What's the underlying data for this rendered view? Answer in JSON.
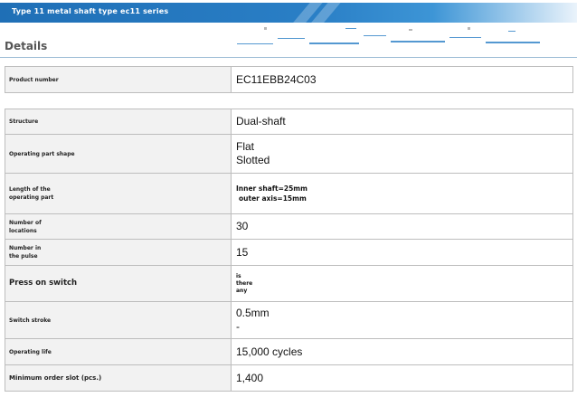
{
  "banner": {
    "title": "Type 11 metal shaft type ec11 series"
  },
  "section": {
    "title": "Details"
  },
  "product": {
    "label": "Product number",
    "value": "EC11EBB24C03"
  },
  "specs": {
    "structure": {
      "label": "Structure",
      "value": "Dual-shaft"
    },
    "operating_part_shape": {
      "label": "Operating part shape",
      "values": [
        "Flat",
        "Slotted"
      ]
    },
    "length": {
      "label_lines": [
        "Length of the",
        "operating part"
      ],
      "values": [
        "Inner shaft=25mm",
        "outer axis=15mm"
      ]
    },
    "locations": {
      "label_lines": [
        "Number of",
        "locations"
      ],
      "value": "30"
    },
    "pulse": {
      "label_lines": [
        "Number in",
        "the pulse"
      ],
      "value": "15"
    },
    "press_switch": {
      "label": "Press on switch",
      "values": [
        "is",
        "there",
        "any"
      ]
    },
    "switch_stroke": {
      "label": "Switch stroke",
      "values": [
        "0.5mm",
        "-"
      ]
    },
    "operating_life": {
      "label": "Operating life",
      "value": "15,000 cycles"
    },
    "min_order": {
      "label": "Minimum order slot (pcs.)",
      "value": "1,400"
    }
  },
  "colors": {
    "banner": "#1f6fb6",
    "label_bg": "#f2f2f2",
    "border": "#bdbdbd"
  }
}
